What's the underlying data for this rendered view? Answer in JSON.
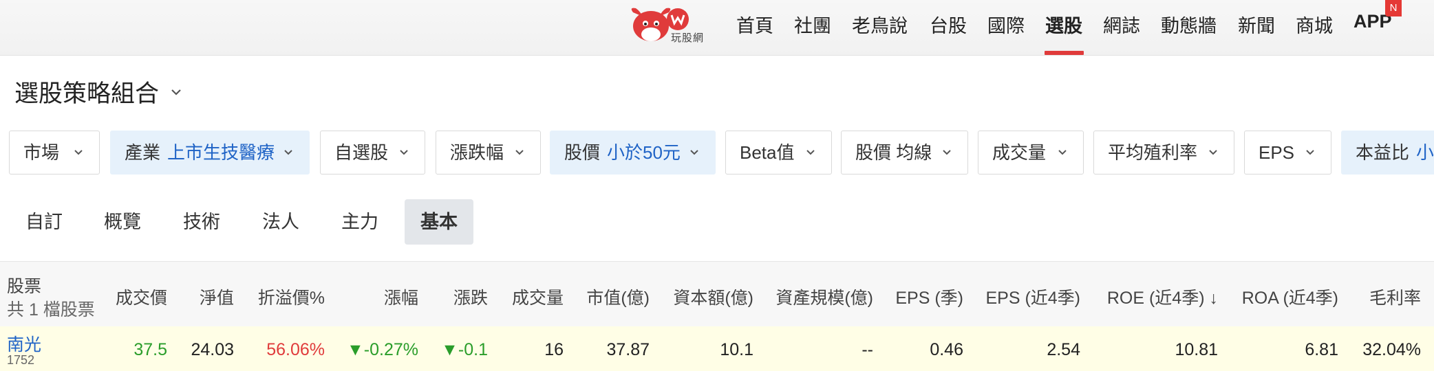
{
  "header": {
    "logo_text": "玩股網",
    "nav": [
      "首頁",
      "社團",
      "老鳥說",
      "台股",
      "國際",
      "選股",
      "網誌",
      "動態牆",
      "新聞",
      "商城",
      "APP"
    ],
    "active": "選股",
    "app_badge": "N",
    "brand_color": "#e03b3b"
  },
  "page": {
    "title": "選股策略組合"
  },
  "filters": [
    {
      "label": "市場",
      "value": ""
    },
    {
      "label": "產業",
      "value": "上市生技醫療"
    },
    {
      "label": "自選股",
      "value": ""
    },
    {
      "label": "漲跌幅",
      "value": ""
    },
    {
      "label": "股價",
      "value": "小於50元"
    },
    {
      "label": "Beta值",
      "value": ""
    },
    {
      "label": "股價 均線",
      "value": ""
    },
    {
      "label": "成交量",
      "value": ""
    },
    {
      "label": "平均殖利率",
      "value": ""
    },
    {
      "label": "EPS",
      "value": ""
    },
    {
      "label": "本益比",
      "value": "小"
    }
  ],
  "tabs": [
    "自訂",
    "概覽",
    "技術",
    "法人",
    "主力",
    "基本"
  ],
  "active_tab": "基本",
  "table": {
    "headers": {
      "stock": "股票",
      "count": "共 1 檔股票",
      "cols": [
        "成交價",
        "淨值",
        "折溢價%",
        "漲幅",
        "漲跌",
        "成交量",
        "市值(億)",
        "資本額(億)",
        "資產規模(億)",
        "EPS (季)",
        "EPS (近4季)",
        "ROE (近4季)",
        "ROA (近4季)",
        "毛利率"
      ],
      "sort_arrow": "↓"
    },
    "rows": [
      {
        "name": "南光",
        "code": "1752",
        "cells": [
          "37.5",
          "24.03",
          "56.06%",
          "▼-0.27%",
          "▼-0.1",
          "16",
          "37.87",
          "10.1",
          "--",
          "0.46",
          "2.54",
          "10.81",
          "6.81",
          "32.04%"
        ]
      }
    ]
  }
}
